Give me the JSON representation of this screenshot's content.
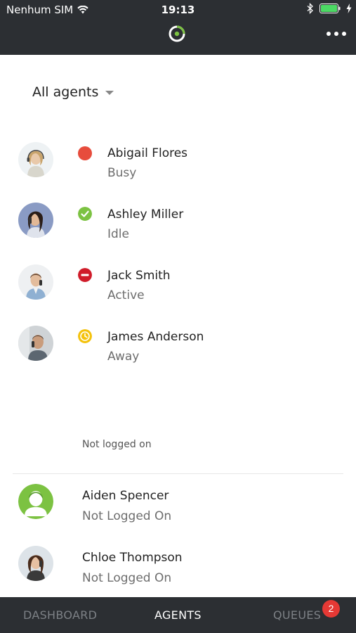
{
  "status_bar": {
    "carrier": "Nenhum SIM",
    "time": "19:13"
  },
  "header": {
    "logo": "ring-logo-icon",
    "menu": "more-dots-icon"
  },
  "filter": {
    "label": "All agents"
  },
  "agents": [
    {
      "name": "Abigail Flores",
      "status": "Busy",
      "status_color": "#e74c3c"
    },
    {
      "name": "Ashley Miller",
      "status": "Idle",
      "status_color": "#7cc242"
    },
    {
      "name": "Jack Smith",
      "status": "Active",
      "status_color": "#d01c2a"
    },
    {
      "name": "James Anderson",
      "status": "Away",
      "status_color": "#f4c20d"
    }
  ],
  "offline_section": {
    "title": "Not logged on",
    "agents": [
      {
        "name": "Aiden Spencer",
        "status": "Not Logged On"
      },
      {
        "name": "Chloe Thompson",
        "status": "Not Logged On"
      }
    ]
  },
  "tabs": {
    "dashboard": "DASHBOARD",
    "agents": "AGENTS",
    "queues": "QUEUES",
    "queues_badge": "2"
  }
}
